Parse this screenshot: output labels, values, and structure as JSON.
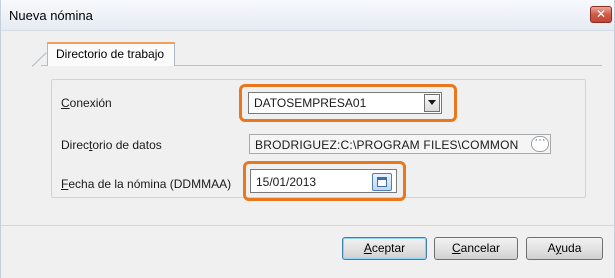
{
  "window": {
    "title": "Nueva nómina",
    "close_glyph": "✕"
  },
  "tabs": [
    {
      "label": "Directorio de trabajo",
      "active": true
    }
  ],
  "form": {
    "connection": {
      "label_first": "C",
      "label_rest": "onexión",
      "value": "DATOSEMPRESA01"
    },
    "data_directory": {
      "label_pre": "Direc",
      "label_under": "t",
      "label_post": "orio de datos",
      "value": "BRODRIGUEZ:C:\\PROGRAM FILES\\COMMON",
      "button_glyph": "···"
    },
    "payroll_date": {
      "label_first": "F",
      "label_rest": "echa de la nómina (DDMMAA)",
      "value": "15/01/2013"
    }
  },
  "buttons": {
    "accept": {
      "u": "A",
      "rest": "ceptar"
    },
    "cancel": {
      "u": "C",
      "rest": "ancelar"
    },
    "help": {
      "pre": "A",
      "u": "y",
      "post": "uda"
    }
  },
  "colors": {
    "highlight": "#e8771d",
    "tab_accent": "#f0a05a"
  },
  "icons": {
    "combo_arrow": "chevron-down-icon",
    "date_picker": "calendar-icon",
    "close": "close-icon"
  }
}
